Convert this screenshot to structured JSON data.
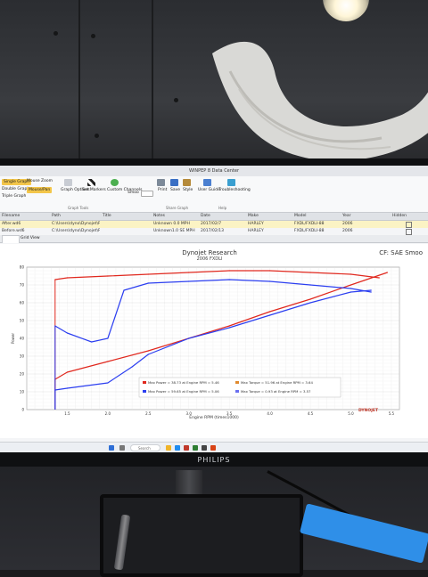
{
  "app": {
    "title": "WINPEP 8 Data Center"
  },
  "ribbon": {
    "single_graph": "Single Graph",
    "double_graph": "Double Graph",
    "triple_graph": "Triple Graph",
    "mouse_zoom": "Mouse Zoom",
    "mouse_pan": "Mouse/Pan",
    "graph_options": "Graph Options",
    "set_markers": "Set Markers",
    "custom_channels": "Custom Channels",
    "smooth": "Smoo",
    "print": "Print",
    "save": "Save",
    "style": "Style",
    "user_guide": "User Guide",
    "troubleshooting": "Troubleshooting",
    "group_graph_tools": "Graph Tools",
    "group_share": "Share Graph",
    "group_help": "Help"
  },
  "file_grid": {
    "headers": [
      "Filename",
      "Path",
      "Title",
      "Notes",
      "Date",
      "Make",
      "Model",
      "Year",
      "Hidden"
    ],
    "rows": [
      [
        "After.wd6",
        "C:\\Users\\dyno\\Dynojet\\Runs\\",
        "",
        "Unknown 0.0 MPH",
        "2017/02/7",
        "HARLEY",
        "FXDL/FXDLI-88",
        "2006",
        ""
      ],
      [
        "Before.wd6",
        "C:\\Users\\dyno\\Dynojet\\Runs\\",
        "",
        "Unknown1.0 SE  MPH",
        "2017/02/13",
        "HARLEY",
        "FXDL/FXDLI-88",
        "2006",
        ""
      ]
    ]
  },
  "subtabs": [
    "",
    "Grid View"
  ],
  "chart": {
    "title": "Dynojet Research",
    "subtitle": "2006  FXDLI",
    "correction": "CF: SAE Smoo",
    "legend": [
      "Max Power = 38.73 at Engine RPM = 5.46",
      "Max Power = 59.65 at Engine RPM = 5.06",
      "Max Torque = 51.96 at Engine RPM = 3.64",
      "Max Torque = 0.93 at Engine RPM = 3.57"
    ],
    "xlabel": "Engine RPM (times1000)",
    "watermark": "DYNOJET"
  },
  "chart_data": {
    "type": "line",
    "xlabel": "Engine RPM (times1000)",
    "ylabel": "Power",
    "xlim": [
      1.0,
      5.6
    ],
    "ylim": [
      0,
      80
    ],
    "x_ticks": [
      "1.5",
      "2.0",
      "2.5",
      "3.0",
      "3.5",
      "4.0",
      "4.5",
      "5.0",
      "5.5"
    ],
    "y_ticks": [
      "0",
      "10",
      "20",
      "30",
      "40",
      "50",
      "60",
      "70",
      "80"
    ],
    "series": [
      {
        "color": "#e0281e",
        "style": "torque-after",
        "x": [
          1.35,
          1.5,
          2.0,
          2.5,
          3.0,
          3.5,
          4.0,
          4.5,
          5.0,
          5.35
        ],
        "y": [
          73,
          74,
          75,
          76,
          77,
          78,
          78,
          77,
          76,
          74
        ]
      },
      {
        "color": "#e0281e",
        "style": "power-after",
        "x": [
          1.35,
          1.5,
          2.0,
          2.5,
          3.0,
          3.5,
          4.0,
          4.5,
          5.0,
          5.45
        ],
        "y": [
          17,
          21,
          27,
          33,
          40,
          47,
          55,
          62,
          70,
          77
        ]
      },
      {
        "color": "#2b3ef0",
        "style": "torque-before",
        "x": [
          1.35,
          1.5,
          1.8,
          2.0,
          2.2,
          2.5,
          3.0,
          3.5,
          4.0,
          4.5,
          5.0,
          5.25
        ],
        "y": [
          47,
          43,
          38,
          40,
          67,
          71,
          72,
          73,
          72,
          70,
          68,
          66
        ]
      },
      {
        "color": "#2b3ef0",
        "style": "power-before",
        "x": [
          1.35,
          1.5,
          2.0,
          2.3,
          2.5,
          3.0,
          3.5,
          4.0,
          4.5,
          5.0,
          5.25
        ],
        "y": [
          11,
          12,
          15,
          24,
          31,
          40,
          46,
          53,
          60,
          66,
          67
        ]
      }
    ]
  },
  "taskbar": {
    "search_placeholder": "Search"
  },
  "monitor": {
    "brand": "PHILIPS"
  }
}
